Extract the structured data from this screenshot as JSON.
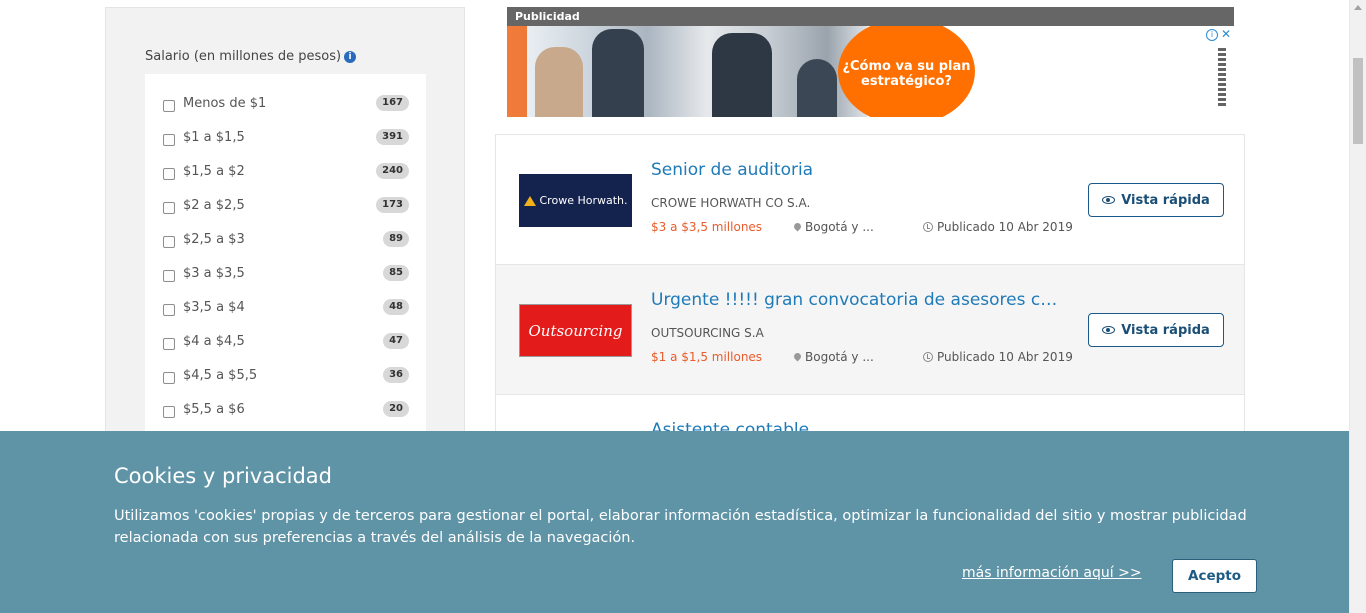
{
  "sidebar": {
    "filter_title": "Salario (en millones de pesos)",
    "options": [
      {
        "label": "Menos de $1",
        "count": "167"
      },
      {
        "label": "$1 a $1,5",
        "count": "391"
      },
      {
        "label": "$1,5 a $2",
        "count": "240"
      },
      {
        "label": "$2 a $2,5",
        "count": "173"
      },
      {
        "label": "$2,5 a $3",
        "count": "89"
      },
      {
        "label": "$3 a $3,5",
        "count": "85"
      },
      {
        "label": "$3,5 a $4",
        "count": "48"
      },
      {
        "label": "$4 a $4,5",
        "count": "47"
      },
      {
        "label": "$4,5 a $5,5",
        "count": "36"
      },
      {
        "label": "$5,5 a $6",
        "count": "20"
      }
    ]
  },
  "ad": {
    "header": "Publicidad",
    "headline": "¿Cómo va su plan estratégico?",
    "info_glyph": "i",
    "close_glyph": "✕",
    "accent_color": "#ff7000"
  },
  "jobs": [
    {
      "logo_text": "Crowe Horwath.",
      "title": "Senior de auditoria",
      "company": "CROWE HORWATH CO S.A.",
      "salary": "$3 a $3,5 millones",
      "location": "Bogotá y ...",
      "published": "Publicado 10 Abr 2019",
      "button": "Vista rápida"
    },
    {
      "logo_text": "Outsourcing",
      "title": "Urgente !!!!! gran convocatoria de asesores call center",
      "company": "OUTSOURCING S.A",
      "salary": "$1 a $1,5 millones",
      "location": "Bogotá y ...",
      "published": "Publicado 10 Abr 2019",
      "button": "Vista rápida"
    },
    {
      "title": "Asistente contable"
    }
  ],
  "cookies": {
    "title": "Cookies y privacidad",
    "text": "Utilizamos 'cookies' propias y de terceros para gestionar el portal, elaborar información estadística, optimizar la funcionalidad del sitio y mostrar publicidad relacionada con sus preferencias a través del análisis de la navegación.",
    "more_info": "más información aquí >>",
    "accept": "Acepto",
    "background_color": "#5f93a6"
  },
  "colors": {
    "link_blue": "#1f7ab8",
    "salary_orange": "#e95c2b"
  }
}
